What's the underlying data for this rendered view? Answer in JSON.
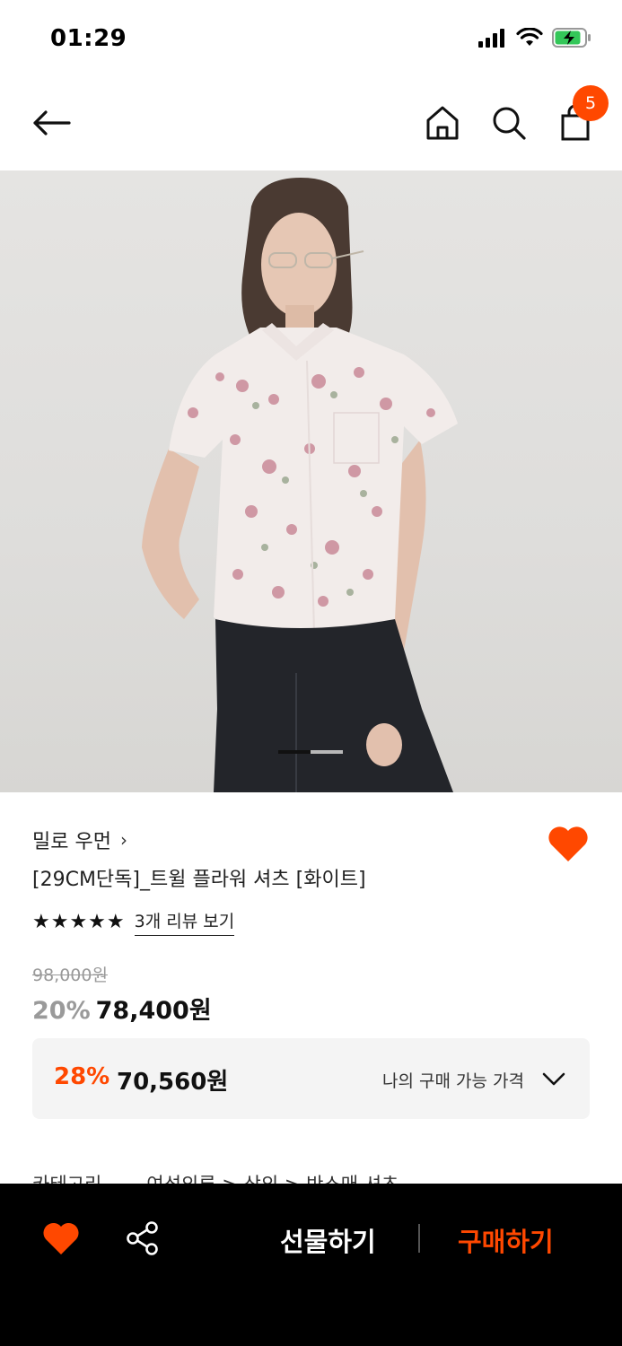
{
  "status_bar": {
    "time": "01:29"
  },
  "nav": {
    "cart_count": "5"
  },
  "hero": {
    "slide_index": 1,
    "slide_total": 2
  },
  "product": {
    "brand": "밀로 우먼",
    "brand_chevron": "›",
    "title": "[29CM단독]_트윌 플라워 셔츠 [화이트]",
    "stars": "★★★★★",
    "rating": 5,
    "review_link": "3개 리뷰 보기",
    "original_price": "98,000원",
    "discount_rate": "20%",
    "sale_price": "78,400원",
    "liked": true
  },
  "my_price": {
    "rate": "28%",
    "price": "70,560원",
    "label": "나의 구매 가능 가격"
  },
  "category": {
    "label": "카테고리",
    "path": "여성의류 > 상의 > 반소매 셔츠"
  },
  "bottom_bar": {
    "gift_label": "선물하기",
    "buy_label": "구매하기"
  },
  "colors": {
    "accent": "#ff4800",
    "text": "#111111",
    "muted": "#999999",
    "bottom_bar": "#000000"
  },
  "icons": [
    "back-arrow-icon",
    "home-icon",
    "search-icon",
    "shopping-bag-icon",
    "heart-icon",
    "share-icon",
    "chevron-down-icon",
    "star-icon"
  ]
}
